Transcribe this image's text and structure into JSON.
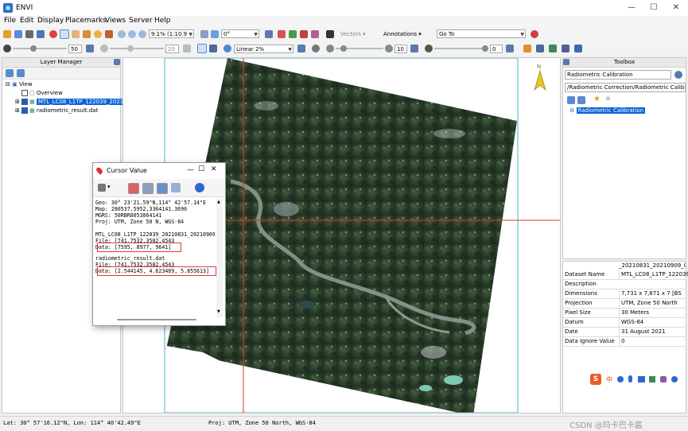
{
  "window": {
    "title": "ENVI",
    "controls": {
      "minimize": "—",
      "maximize": "☐",
      "close": "✕"
    }
  },
  "menu": [
    "File",
    "Edit",
    "Display",
    "Placemarks",
    "Views",
    "Server",
    "Help"
  ],
  "toolbar1": {
    "zoom_value": "9.1% (1:10.9",
    "rotation_value": "0°",
    "vectors_label": "Vectors",
    "annotations_label": "Annotations",
    "goto_value": "Go To"
  },
  "toolbar2": {
    "brightness_value": "50",
    "contrast_value": "20",
    "stretch_value": "Linear 2%",
    "sharpen_value": "10",
    "transparency_value": "0"
  },
  "layer_manager": {
    "title": "Layer Manager",
    "root": "View",
    "items": [
      "Overview",
      "MTL_LC08_L1TP_122039_2021083",
      "radiometric_result.dat"
    ]
  },
  "toolbox": {
    "title": "Toolbox",
    "search_value": "Radiometric Calibration",
    "path_value": "/Radiometric Correction/Radiometric Calib",
    "result_item": "Radiometric Calibration"
  },
  "metadata": {
    "header_value": "_20210831_20210909_01_",
    "rows": [
      {
        "key": "Dataset Name",
        "value": "MTL_LC08_L1TP_122039_2"
      },
      {
        "key": "Description",
        "value": ""
      },
      {
        "key": "Dimensions",
        "value": "7,731 x 7,871 x 7 [BS"
      },
      {
        "key": "Projection",
        "value": "UTM, Zone 50 North"
      },
      {
        "key": "Pixel Size",
        "value": "30 Meters"
      },
      {
        "key": "Datum",
        "value": "WGS-84"
      },
      {
        "key": "Date",
        "value": "31 August 2021"
      },
      {
        "key": "Data Ignore Value",
        "value": "0"
      }
    ]
  },
  "cursor_value": {
    "title": "Cursor Value",
    "lines": [
      "Geo: 30° 23'21.59\"N,114° 42'57.14\"E",
      "Map: 280537.5952,3364141.3696",
      "MGRS: 50RBR8053864141",
      "Proj: UTM, Zone 50 N, WGS-84",
      "",
      "MTL_LC08_L1TP_122039_20210831_20210909_0",
      "  File: [741.7532,3582.4543",
      "  Data: [7595, 8977, 9641]",
      "",
      "radiometric_result.dat",
      "  File: [741.7532,3582.4543",
      "  Data: [2.544145, 4.623489, 5.855613]"
    ]
  },
  "statusbar": {
    "latlon": "Lat: 30° 57'16.12\"N, Lon: 114° 40'42.49\"E",
    "proj": "Proj: UTM, Zone 50 North, WGS-84",
    "watermark": "CSDN @玛卡巴卡酱"
  },
  "ime_label": "中"
}
